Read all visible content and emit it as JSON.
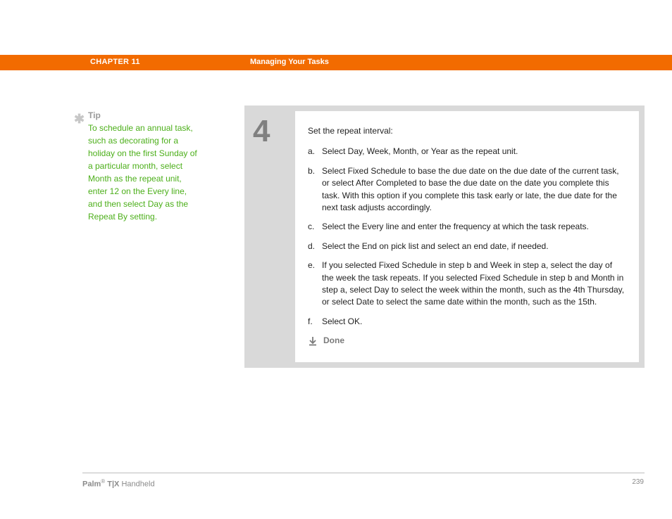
{
  "header": {
    "chapter": "CHAPTER 11",
    "title": "Managing Your Tasks"
  },
  "tip": {
    "label": "Tip",
    "body": "To schedule an annual task, such as decorating for a holiday on the first Sunday of a particular month, select Month as the repeat unit, enter 12 on the Every line, and then select Day as the Repeat By setting."
  },
  "step": {
    "number": "4",
    "heading": "Set the repeat interval:",
    "items": [
      {
        "marker": "a.",
        "text": "Select Day, Week, Month, or Year as the repeat unit."
      },
      {
        "marker": "b.",
        "text": "Select Fixed Schedule to base the due date on the due date of the current task, or select After Completed to base the due date on the date you complete this task. With this option if you complete this task early or late, the due date for the next task adjusts accordingly."
      },
      {
        "marker": "c.",
        "text": "Select the Every line and enter the frequency at which the task repeats."
      },
      {
        "marker": "d.",
        "text": "Select the End on pick list and select an end date, if needed."
      },
      {
        "marker": "e.",
        "text": "If you selected Fixed Schedule in step b and Week in step a, select the day of the week the task repeats. If you selected Fixed Schedule in step b and Month in step a, select Day to select the week within the month, such as the 4th Thursday, or select Date to select the same date within the month, such as the 15th."
      },
      {
        "marker": "f.",
        "text": "Select OK."
      }
    ],
    "done": "Done"
  },
  "footer": {
    "brand": "Palm",
    "model": " T|X",
    "suffix": " Handheld",
    "page": "239"
  }
}
